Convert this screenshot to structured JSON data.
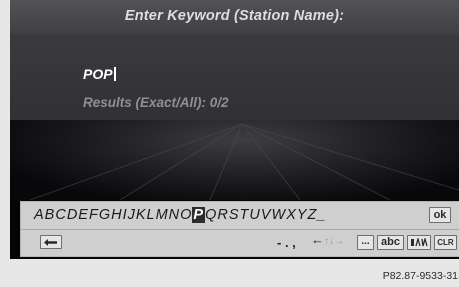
{
  "header": {
    "title": "Enter Keyword (Station Name):"
  },
  "entry": {
    "value": "POP",
    "results_text": "Results (Exact/All): 0/2"
  },
  "keyboard": {
    "letters_before": "ABCDEFGHIJKLMNO",
    "selected_letter": "P",
    "letters_after": "QRSTUVWXYZ_",
    "ok_label": "ok",
    "back_icon": "back-arrow-icon",
    "punctuation": "- . ,",
    "arrow_left": "←",
    "arrow_up": "↑",
    "arrow_down": "↓",
    "arrow_right": "→",
    "ellipsis_label": "...",
    "abc_label": "abc",
    "symbols_icon": "special-characters-icon",
    "clr_label": "CLR"
  },
  "caption": "P82.87-9533-31",
  "colors": {
    "screen_bg": "#050506",
    "title_bar": "#4a4a4f",
    "keyboard_bg": "#cfcfd0",
    "selected_key": "#2c2c2c"
  }
}
